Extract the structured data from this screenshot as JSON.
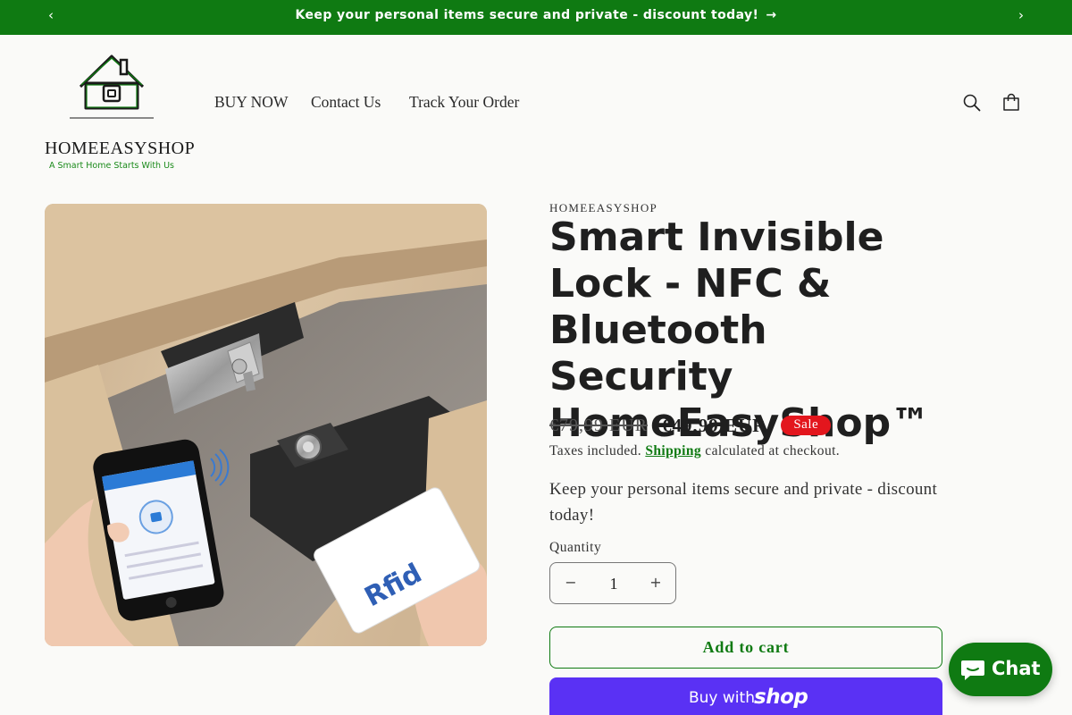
{
  "announcement": {
    "message": "Keep your personal items secure and private - discount today!",
    "arrow": "→",
    "prev_icon": "‹",
    "next_icon": "›"
  },
  "header": {
    "logo_text": "HOMEEASYSHOP",
    "logo_tagline": "A Smart Home Starts With Us",
    "menu": [
      {
        "label": "BUY NOW"
      },
      {
        "label": "Contact Us"
      },
      {
        "label": "Track Your Order"
      }
    ],
    "icons": [
      "search-icon",
      "cart-icon"
    ]
  },
  "product": {
    "vendor": "HOMEEASYSHOP",
    "title": "Smart Invisible Lock - NFC & Bluetooth Security HomeEasyShop™",
    "price_regular": "€79,99 EUR",
    "price_sale": "€49,99 EUR",
    "badge": "Sale",
    "tax_prefix": "Taxes included.",
    "tax_link": "Shipping",
    "tax_suffix": "calculated at checkout.",
    "description": "Keep your personal items secure and private - discount today!",
    "quantity_label": "Quantity",
    "quantity_value": "1",
    "minus": "−",
    "plus": "+",
    "add_to_cart": "Add to cart",
    "buy_with": "Buy with",
    "shop_brand": "shop",
    "image_text": "Rfid"
  },
  "chat": {
    "label": "Chat"
  },
  "colors": {
    "brand_green": "#0f7a12",
    "sale_red": "#e3161d",
    "shop_pay_purple": "#5a31f4",
    "background": "#fafaf8"
  }
}
